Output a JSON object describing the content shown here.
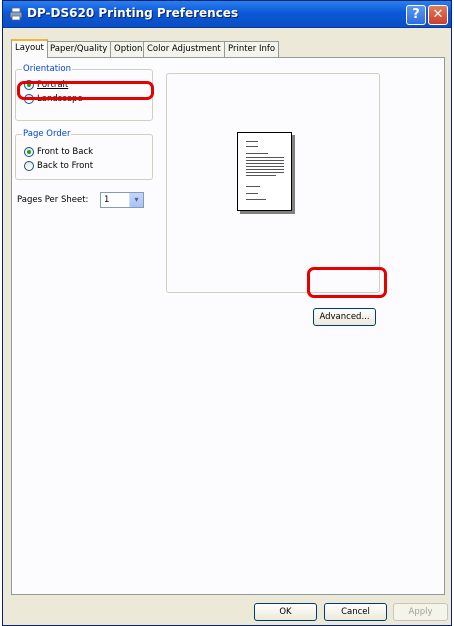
{
  "window": {
    "title": "DP-DS620 Printing Preferences",
    "help_glyph": "?",
    "close_glyph": "✕"
  },
  "tabs": [
    {
      "label": "Layout",
      "active": true
    },
    {
      "label": "Paper/Quality",
      "active": false
    },
    {
      "label": "Option",
      "active": false
    },
    {
      "label": "Color Adjustment",
      "active": false
    },
    {
      "label": "Printer Info",
      "active": false
    }
  ],
  "orientation": {
    "legend": "Orientation",
    "options": [
      {
        "label": "Portrait",
        "checked": true
      },
      {
        "label": "Landscape",
        "checked": false
      }
    ]
  },
  "page_order": {
    "legend": "Page Order",
    "options": [
      {
        "label": "Front to Back",
        "checked": true
      },
      {
        "label": "Back to Front",
        "checked": false
      }
    ]
  },
  "pages_per_sheet": {
    "label": "Pages Per Sheet:",
    "value": "1",
    "arrow": "▾"
  },
  "buttons": {
    "advanced": "Advanced...",
    "ok": "OK",
    "cancel": "Cancel",
    "apply": "Apply"
  },
  "colors": {
    "titlebar": "#0b58d8",
    "legend_text": "#0046d5",
    "highlight": "#e60000",
    "radio_check": "#21a121"
  }
}
